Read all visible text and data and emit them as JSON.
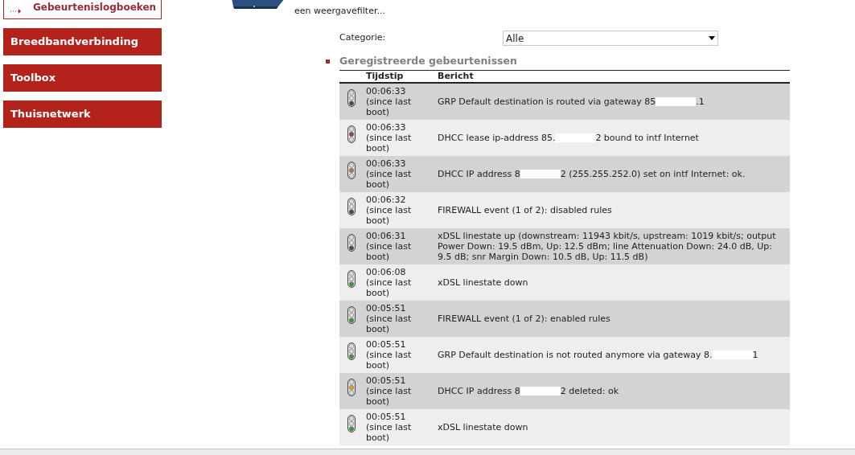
{
  "sidebar": {
    "items": [
      {
        "label": "Gebeurtenislogboeken",
        "selected": true
      },
      {
        "label": "Breedbandverbinding",
        "selected": false
      },
      {
        "label": "Toolbox",
        "selected": false
      },
      {
        "label": "Thuisnetwerk",
        "selected": false
      }
    ]
  },
  "intro": [
    "een weergavefilter..."
  ],
  "filter": {
    "label": "Categorie:",
    "value": "Alle"
  },
  "section_title": "Geregistreerde gebeurtenissen",
  "table": {
    "columns": [
      "Tijdstip",
      "Bericht"
    ],
    "rows": [
      {
        "time": "00:06:33",
        "time_note": "(since last boot)",
        "kind": "bottom",
        "color": "#4a4a4a",
        "message": [
          "GRP Default destination is routed via gateway 85",
          ".1"
        ]
      },
      {
        "time": "00:06:33",
        "time_note": "(since last boot)",
        "kind": "middle",
        "color": "#7a5048",
        "message": [
          "DHCC lease ip-address 85.",
          "2 bound to intf Internet"
        ]
      },
      {
        "time": "00:06:33",
        "time_note": "(since last boot)",
        "kind": "middle",
        "color": "#b07840",
        "message": [
          "DHCC IP address 8",
          "2 (255.255.252.0) set on intf Internet: ok."
        ]
      },
      {
        "time": "00:06:32",
        "time_note": "(since last boot)",
        "kind": "bottom",
        "color": "#4a4a4a",
        "message": [
          "FIREWALL event (1 of 2): disabled rules"
        ]
      },
      {
        "time": "00:06:31",
        "time_note": "(since last boot)",
        "kind": "bottom",
        "color": "#4a4a4a",
        "message": [
          "xDSL linestate up (downstream: 11943 kbit/s, upstream: 1019 kbit/s; output Power Down: 19.5 dBm, Up: 12.5 dBm; line Attenuation Down: 24.0 dB, Up: 9.5 dB; snr Margin Down: 10.5 dB, Up: 11.5 dB)"
        ]
      },
      {
        "time": "00:06:08",
        "time_note": "(since last boot)",
        "kind": "bottom",
        "color": "#3a9a3a",
        "message": [
          "xDSL linestate down"
        ]
      },
      {
        "time": "00:05:51",
        "time_note": "(since last boot)",
        "kind": "bottom",
        "color": "#3a9a3a",
        "message": [
          "FIREWALL event (1 of 2): enabled rules"
        ]
      },
      {
        "time": "00:05:51",
        "time_note": "(since last boot)",
        "kind": "bottom",
        "color": "#3a9a3a",
        "message": [
          "GRP Default destination is not routed anymore via gateway 8.",
          "1"
        ]
      },
      {
        "time": "00:05:51",
        "time_note": "(since last boot)",
        "kind": "middle",
        "color": "#e0a020",
        "message": [
          "DHCC IP address 8",
          "2 deleted: ok"
        ]
      },
      {
        "time": "00:05:51",
        "time_note": "(since last boot)",
        "kind": "bottom",
        "color": "#3a9a3a",
        "message": [
          "xDSL linestate down"
        ]
      }
    ]
  }
}
